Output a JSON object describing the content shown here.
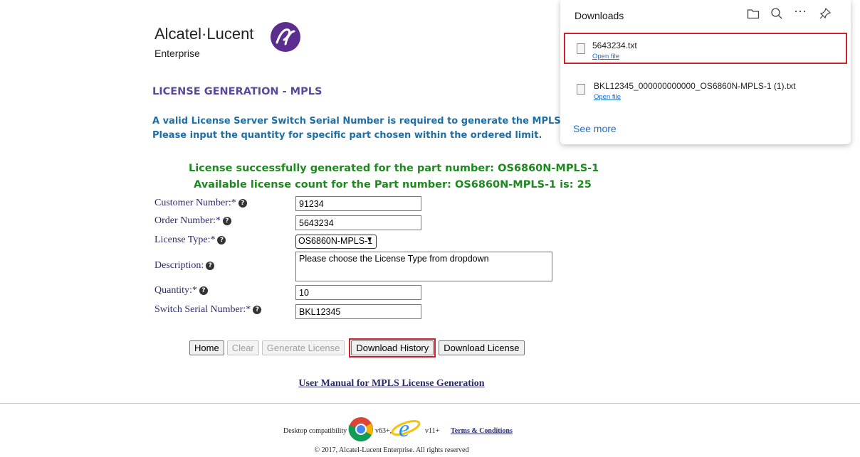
{
  "logo": {
    "brand": "Alcatel·Lucent",
    "sub": "Enterprise"
  },
  "page": {
    "title": "LICENSE GENERATION - MPLS",
    "info_line1": "A valid License Server Switch Serial Number is required to generate the MPLS Li",
    "info_line2": "Please input the quantity for specific part chosen within the ordered limit.",
    "success_line1": "License successfully generated for the part number: OS6860N-MPLS-1",
    "success_line2": "Available license count for the Part number: OS6860N-MPLS-1 is: 25"
  },
  "form": {
    "customer_number": {
      "label": "Customer Number:*",
      "value": "91234"
    },
    "order_number": {
      "label": "Order Number:*",
      "value": "5643234"
    },
    "license_type": {
      "label": "License Type:*",
      "value": "OS6860N-MPLS-1"
    },
    "description": {
      "label": "Description:",
      "value": "Please choose the License Type from dropdown"
    },
    "quantity": {
      "label": "Quantity:*",
      "value": "10"
    },
    "switch_serial": {
      "label": "Switch Serial Number:*",
      "value": "BKL12345"
    }
  },
  "buttons": {
    "home": "Home",
    "clear": "Clear",
    "generate": "Generate License",
    "download_history": "Download History",
    "download_license": "Download License"
  },
  "manual_link": "User Manual for MPLS License Generation",
  "footer": {
    "compat": "Desktop compatibility with",
    "chrome_version": "v63+,",
    "ie_version": "v11+",
    "terms": "Terms & Conditions",
    "copyright": "© 2017, Alcatel-Lucent Enterprise. All rights reserved"
  },
  "downloads": {
    "title": "Downloads",
    "items": [
      {
        "name": "5643234.txt",
        "action": "Open file"
      },
      {
        "name": "BKL12345_000000000000_OS6860N-MPLS-1 (1).txt",
        "action": "Open file"
      }
    ],
    "see_more": "See more"
  },
  "colors": {
    "title_purple": "#5b4a9b",
    "info_blue": "#1e6fa8",
    "success_green": "#1d8a1d",
    "highlight_red": "#d4202c",
    "link_blue": "#1a6fd0"
  }
}
